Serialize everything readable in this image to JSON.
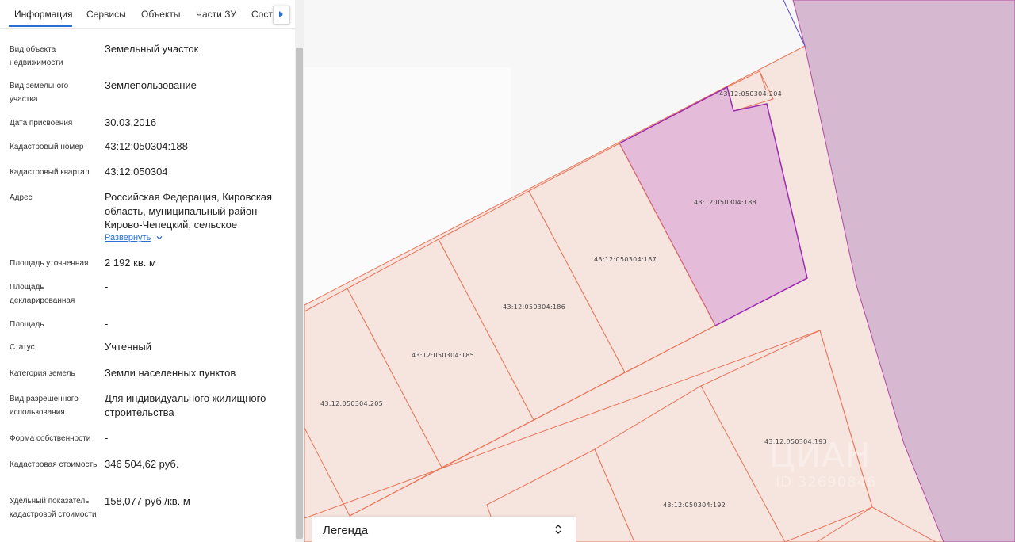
{
  "tabs": {
    "items": [
      "Информация",
      "Сервисы",
      "Объекты",
      "Части ЗУ",
      "Соста"
    ],
    "active": "Информация"
  },
  "info": {
    "rows": [
      {
        "label": "Вид объекта недвижимости",
        "value": "Земельный участок"
      },
      {
        "label": "Вид земельного участка",
        "value": "Землепользование"
      },
      {
        "label": "Дата присвоения",
        "value": "30.03.2016"
      },
      {
        "label": "Кадастровый номер",
        "value": "43:12:050304:188"
      },
      {
        "label": "Кадастровый квартал",
        "value": "43:12:050304"
      },
      {
        "label": "Адрес",
        "value": "Российская Федерация, Кировская область, муниципальный район Кирово-Чепецкий, сельское"
      },
      {
        "label": "Площадь уточненная",
        "value": "2 192 кв. м"
      },
      {
        "label": "Площадь декларированная",
        "value": "-"
      },
      {
        "label": "Площадь",
        "value": "-"
      },
      {
        "label": "Статус",
        "value": "Учтенный"
      },
      {
        "label": "Категория земель",
        "value": "Земли населенных пунктов"
      },
      {
        "label": "Вид разрешенного использования",
        "value": "Для индивидуального жилищного строительства"
      },
      {
        "label": "Форма собственности",
        "value": "-"
      },
      {
        "label": "Кадастровая стоимость",
        "value": "346 504,62 руб."
      },
      {
        "label": "Удельный показатель кадастровой стоимости",
        "value": "158,077 руб./кв. м"
      }
    ],
    "expand_link": "Развернуть"
  },
  "map": {
    "parcels": [
      {
        "id": "43:12:050304:204"
      },
      {
        "id": "43:12:050304:188",
        "selected": true
      },
      {
        "id": "43:12:050304:187"
      },
      {
        "id": "43:12:050304:186"
      },
      {
        "id": "43:12:050304:185"
      },
      {
        "id": "43:12:050304:205"
      },
      {
        "id": "43:12:050304:193"
      },
      {
        "id": "43:12:050304:192"
      }
    ],
    "colors": {
      "parcel_fill": "#f6e4df",
      "parcel_border": "#e8765a",
      "selected_fill": "#e4bcd9",
      "selected_border": "#9b2ab0",
      "region_fill": "#d6b8d0",
      "background": "#f7f7f7"
    }
  },
  "legend": {
    "title": "Легенда"
  },
  "watermark": {
    "brand": "ЦИАН",
    "id": "ID 32690846"
  }
}
